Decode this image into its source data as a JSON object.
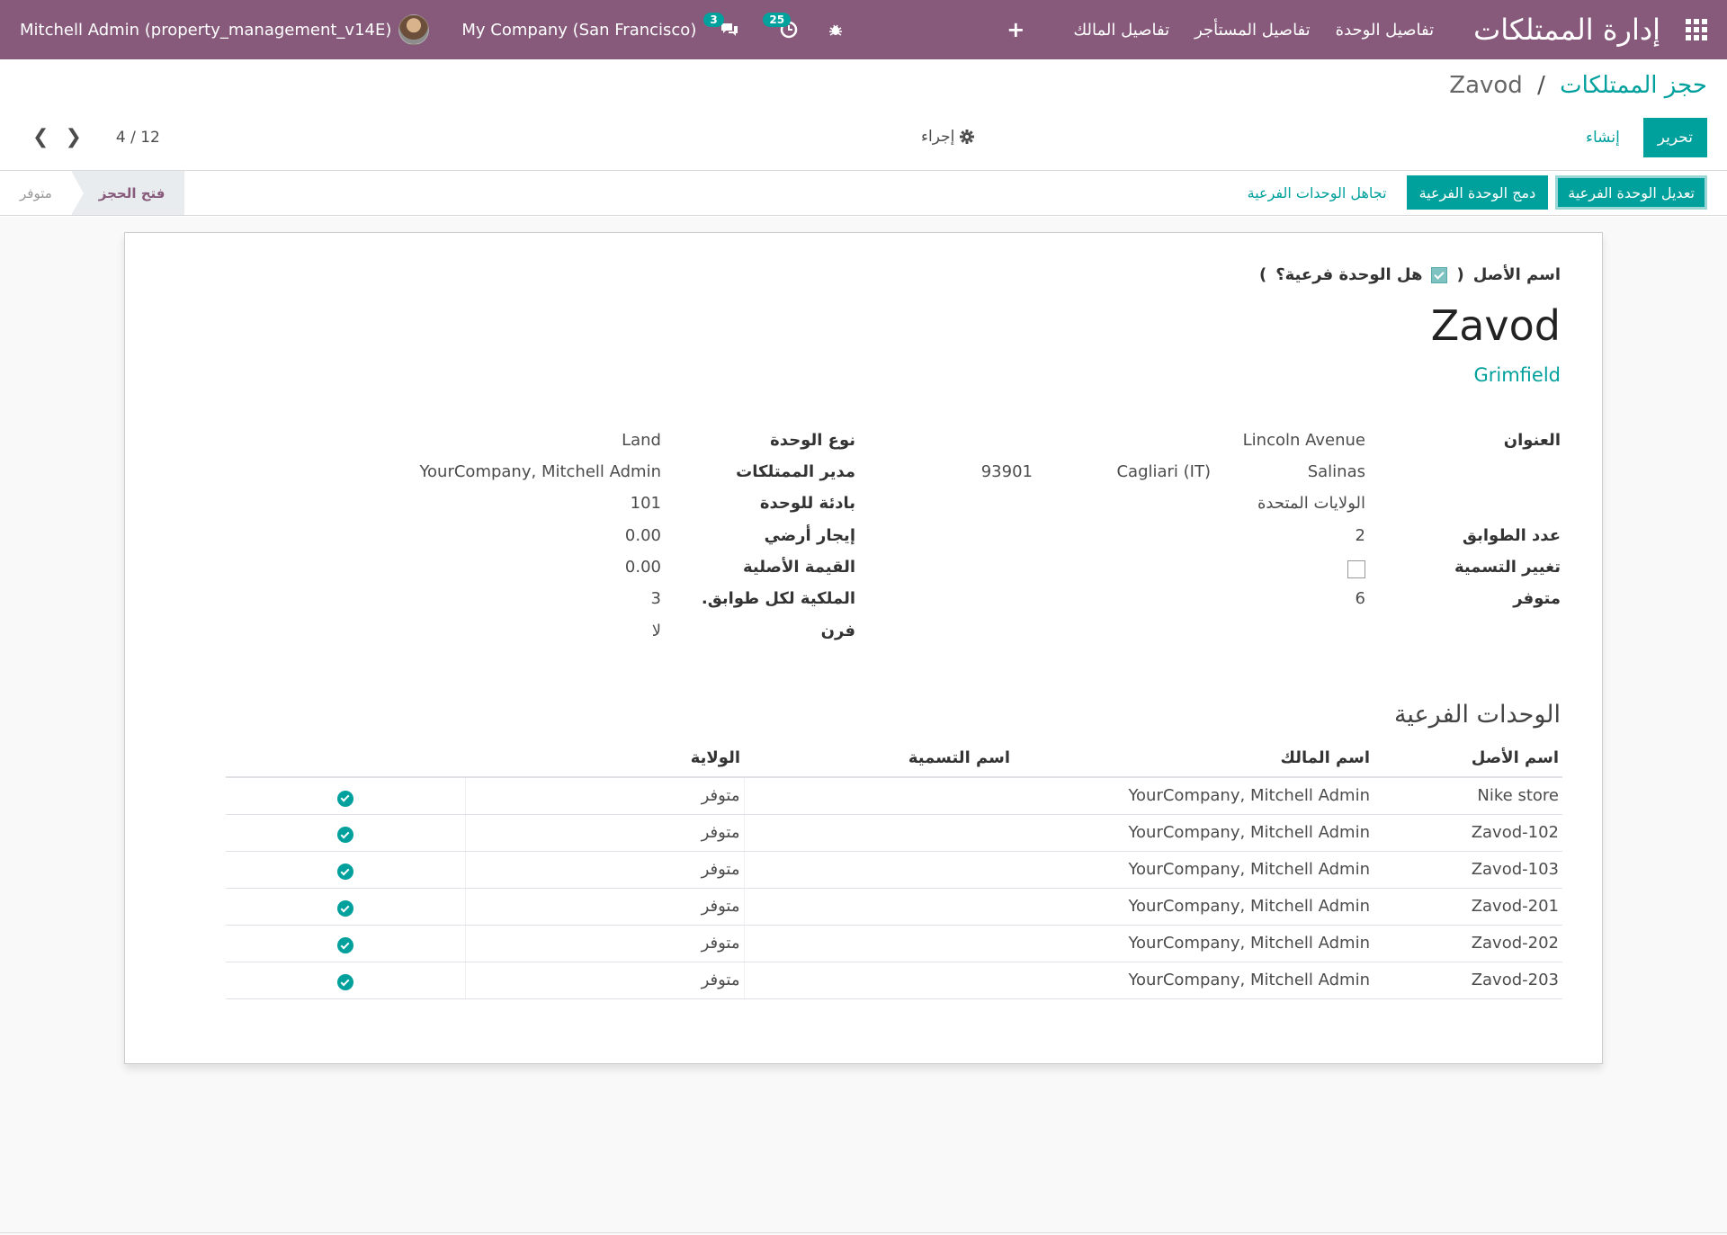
{
  "navbar": {
    "brand": "إدارة الممتلكات",
    "menu": [
      "تفاصيل الوحدة",
      "تفاصيل المستأجر",
      "تفاصيل المالك"
    ],
    "user": "Mitchell Admin (property_management_v14E)",
    "company": "My Company (San Francisco)",
    "messages_count": "3",
    "activities_count": "25",
    "plus": "+"
  },
  "breadcrumb": {
    "parent": "حجز الممتلكات",
    "separator": "/",
    "current": "Zavod"
  },
  "buttons": {
    "edit": "تحرير",
    "create": "إنشاء",
    "action": "إجراء"
  },
  "pager": {
    "value": "4 / 12"
  },
  "statusbar": {
    "buttons": [
      "تعديل الوحدة الفرعية",
      "دمج الوحدة الفرعية",
      "تجاهل الوحدات الفرعية"
    ],
    "stages": [
      "فتح الحجز",
      "متوفر"
    ]
  },
  "form": {
    "title_label": "اسم الأصل",
    "subunit_label": "هل الوحدة فرعية؟",
    "paren_open": "(",
    "paren_close": ")",
    "name": "Zavod",
    "parent": "Grimfield",
    "left": {
      "address_label": "العنوان",
      "street": "Lincoln Avenue",
      "city": "Salinas",
      "state": "Cagliari (IT)",
      "zip": "93901",
      "country": "الولايات المتحدة",
      "floors_label": "عدد الطوابق",
      "floors": "2",
      "rename_label": "تغيير التسمية",
      "available_label": "متوفر",
      "available": "6"
    },
    "right": {
      "unit_type_label": "نوع الوحدة",
      "unit_type": "Land",
      "manager_label": "مدير الممتلكات",
      "manager": "YourCompany, Mitchell Admin",
      "prefix_label": "بادئة للوحدة",
      "prefix": "101",
      "ground_rent_label": "إيجار أرضي",
      "ground_rent": "0.00",
      "original_value_label": "القيمة الأصلية",
      "original_value": "0.00",
      "per_floor_label": "الملكية لكل طوابق.",
      "per_floor": "3",
      "oven_label": "فرن",
      "oven": "لا"
    }
  },
  "subunits": {
    "title": "الوحدات الفرعية",
    "headers": [
      "اسم الأصل",
      "اسم المالك",
      "اسم التسمية",
      "الولاية"
    ],
    "rows": [
      {
        "name": "Nike store",
        "owner": "YourCompany, Mitchell Admin",
        "label": "",
        "state": "متوفر"
      },
      {
        "name": "Zavod-102",
        "owner": "YourCompany, Mitchell Admin",
        "label": "",
        "state": "متوفر"
      },
      {
        "name": "Zavod-103",
        "owner": "YourCompany, Mitchell Admin",
        "label": "",
        "state": "متوفر"
      },
      {
        "name": "Zavod-201",
        "owner": "YourCompany, Mitchell Admin",
        "label": "",
        "state": "متوفر"
      },
      {
        "name": "Zavod-202",
        "owner": "YourCompany, Mitchell Admin",
        "label": "",
        "state": "متوفر"
      },
      {
        "name": "Zavod-203",
        "owner": "YourCompany, Mitchell Admin",
        "label": "",
        "state": "متوفر"
      }
    ]
  },
  "colors": {
    "navbar": "#875a7b",
    "accent": "#00a09d"
  }
}
